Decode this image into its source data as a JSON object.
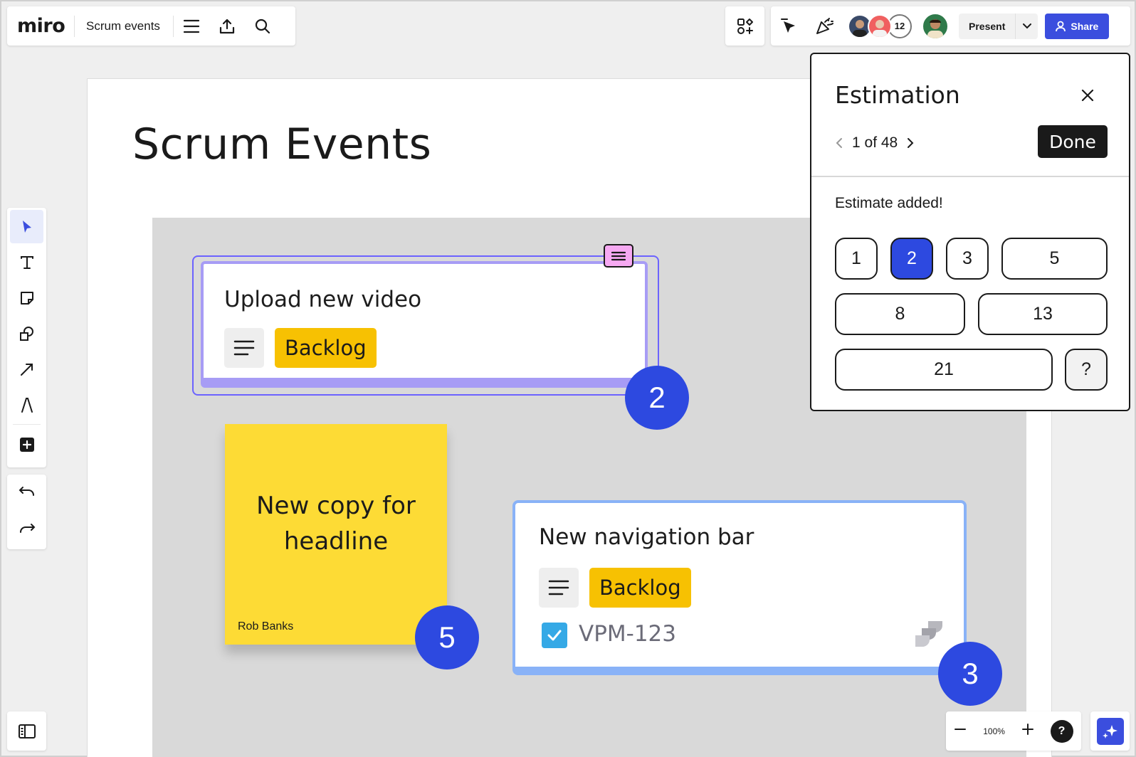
{
  "app": {
    "logo": "miro",
    "board_title": "Scrum events"
  },
  "header": {
    "collaborator_count": "12",
    "present_label": "Present",
    "share_label": "Share"
  },
  "board": {
    "heading": "Scrum Events"
  },
  "cards": [
    {
      "title": "Upload new video",
      "status": "Backlog",
      "estimate": "2"
    },
    {
      "title": "New navigation bar",
      "status": "Backlog",
      "issue_key": "VPM-123",
      "estimate": "3"
    }
  ],
  "sticky": {
    "text_line1": "New copy for",
    "text_line2": "headline",
    "author": "Rob Banks",
    "estimate": "5"
  },
  "estimation": {
    "title": "Estimation",
    "pager": "1 of 48",
    "done_label": "Done",
    "message": "Estimate added!",
    "options": [
      "1",
      "2",
      "3",
      "5",
      "8",
      "13",
      "21",
      "?"
    ],
    "selected": "2"
  },
  "zoom": {
    "level": "100%",
    "help": "?"
  },
  "colors": {
    "accent": "#3b4ede",
    "badge": "#2d49e0",
    "backlog": "#f7c102",
    "sticky": "#fddb35"
  }
}
